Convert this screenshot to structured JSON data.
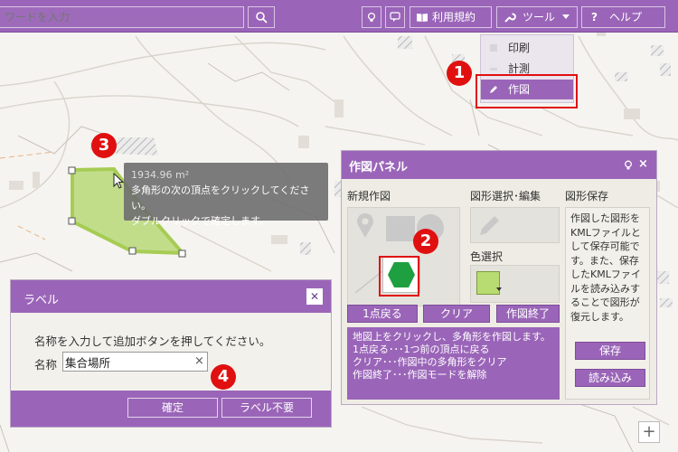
{
  "search": {
    "placeholder": "ワードを入力"
  },
  "toolbar": {
    "terms_label": "利用規約",
    "tools_label": "ツール",
    "help_label": "ヘルプ"
  },
  "tools_menu": {
    "items": [
      {
        "label": "印刷",
        "icon": "print-icon"
      },
      {
        "label": "計測",
        "icon": "measure-icon"
      },
      {
        "label": "作図",
        "icon": "pencil-icon",
        "active": true
      }
    ]
  },
  "steps": [
    "1",
    "2",
    "3",
    "4"
  ],
  "tooltip": {
    "area": "1934.96 m²",
    "line1": "多角形の次の頂点をクリックしてください。",
    "line2": "ダブルクリックで確定します。"
  },
  "panel": {
    "title": "作図パネル",
    "new_label": "新規作図",
    "select_label": "図形選択･編集",
    "save_label": "図形保存",
    "color_label": "色選択",
    "undo_button": "1点戻る",
    "clear_button": "クリア",
    "end_button": "作図終了",
    "help_lines": [
      "地図上をクリックし、多角形を作図します。",
      "1点戻る･･･1つ前の頂点に戻る",
      "クリア･･･作図中の多角形をクリア",
      "作図終了･･･作図モードを解除"
    ],
    "save_desc": "作図した図形をKMLファイルとして保存可能です。また、保存したKMLファイルを読み込みすることで図形が復元します。",
    "save_button": "保存",
    "load_button": "読み込み",
    "accent_color": "#9a65b8",
    "polygon_color": "#1ea040"
  },
  "label_dialog": {
    "title": "ラベル",
    "message": "名称を入力して追加ボタンを押してください。",
    "name_label": "名称",
    "name_value": "集合場所",
    "confirm_button": "確定",
    "no_label_button": "ラベル不要"
  },
  "zoom": {
    "plus": "+"
  }
}
